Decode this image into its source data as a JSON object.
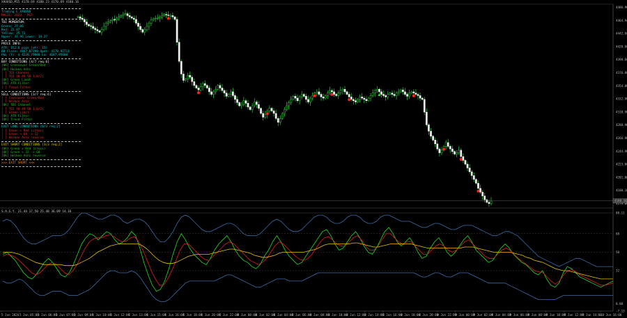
{
  "symbol_line": "XAUUSD,M15  4170.69  4180.23  4170.69  4180.16",
  "indicator_line": "S.A.G.Y.  21.44  17.50  25.48  36.09  14.16",
  "panel": {
    "title": "Trading E  XAUUSD",
    "title_sub": "MAGIC: 2024 · M15",
    "tdi": {
      "header": "TDI MOMENTUM:",
      "lines": [
        "Green: 27.06",
        "Red: 22.87",
        "Yellow: 25.71",
        "Upper: 37.96  Lower: 14.27"
      ]
    },
    "price": {
      "header": "PRICE INFO:",
      "lines": [
        "ATR: 152.6 pips  (atr: 15)",
        "BB Close: 4167.87290  Open: 4178.97711",
        "P&L (Y): $-4220.79800  Lo: 4187.95000"
      ]
    },
    "buy": {
      "header": "BUY CONDITIONS  [4/7  req:6]",
      "items": [
        {
          "state": "ok",
          "text": "[OK] Crossover Green/Red"
        },
        {
          "state": "ok",
          "text": "[OK] Heiken Ashi"
        },
        {
          "state": "no",
          "text": "[ ] TDI Channel"
        },
        {
          "state": "no",
          "text": "[ ] TDI (0-49-50-1,0/2)"
        },
        {
          "state": "ok",
          "text": "[OK] Green Limit"
        },
        {
          "state": "ok",
          "text": "[OK] ATR Filter"
        },
        {
          "state": "no",
          "text": "[ ] Trend Filter"
        }
      ]
    },
    "sell": {
      "header": "SELL CONDITIONS  [3/7  req:6]",
      "items": [
        {
          "state": "no",
          "text": "[ ] Crossover Green/Red"
        },
        {
          "state": "no",
          "text": "[ ] Heiken Ashi"
        },
        {
          "state": "ok",
          "text": "[OK] TDI Channel"
        },
        {
          "state": "no",
          "text": "[ ] TDI (0-49-50-1,0/2)"
        },
        {
          "state": "no",
          "text": "[ ] Green Limit"
        },
        {
          "state": "ok",
          "text": "[OK] ATR Filter"
        },
        {
          "state": "ok",
          "text": "[OK] Trend Filter"
        }
      ]
    },
    "exit_long": {
      "header": "EXIT LONG CONDITIONS  [0/3  req:2]",
      "items": [
        {
          "state": "no",
          "text": "[ ] Green < Red (cross)"
        },
        {
          "state": "no",
          "text": "[ ] Green > 68 -> 32"
        },
        {
          "state": "no",
          "text": "[ ] Heiken Ashi reverse"
        }
      ]
    },
    "exit_short": {
      "header": "EXIT SHORT CONDITIONS  [3/3  req:2]",
      "items": [
        {
          "state": "ok",
          "text": "[OK] Green > Red (cross)"
        },
        {
          "state": "ok",
          "text": "[OK] Green < 32 -> 68"
        },
        {
          "state": "ok",
          "text": "[OK] Heiken Ashi reverse"
        }
      ]
    },
    "signal": ">>> EXIT SHORT <<<"
  },
  "price_axis": [
    "4486.90",
    "4464.94",
    "4442.60",
    "4420.60",
    "4398.60",
    "4376.80",
    "4354.80",
    "4332.90",
    "4310.90",
    "4288.90",
    "4266.90",
    "4244.90",
    "4223.00",
    "4201.00",
    "4180.16",
    "4179.00"
  ],
  "current_price": "4180.16",
  "indicator_axis": [
    "88.11",
    "68",
    "50",
    "32",
    "0.00",
    "-7.13"
  ],
  "time_axis": [
    "5 Jun 2026",
    "5 Jun 05:00",
    "5 Jun 06:00",
    "5 Jun 07:00",
    "5 Jun 09:00",
    "5 Jun 10:00",
    "5 Jun 12:00",
    "5 Jun 13:00",
    "5 Jun 15:00",
    "5 Jun 16:00",
    "5 Jun 18:00",
    "5 Jun 20:00",
    "5 Jun 22:00",
    "8 Jun 00:00",
    "8 Jun 02:00",
    "8 Jun 04:00",
    "8 Jun 06:00",
    "8 Jun 08:00",
    "8 Jun 10:00",
    "8 Jun 12:00",
    "8 Jun 14:00",
    "8 Jun 16:00",
    "8 Jun 18:00",
    "8 Jun 20:00",
    "8 Jun 22:00",
    "9 Jun 00:00",
    "9 Jun 02:00",
    "9 Jun 04:00",
    "9 Jun 06:00",
    "9 Jun 08:00",
    "9 Jun 10:00",
    "9 Jun 12:00",
    "9 Jun 14:00",
    "10 Jun 16:00"
  ],
  "chart_data": {
    "type": "line",
    "price_series_close": [
      4470,
      4468,
      4466,
      4462,
      4458,
      4456,
      4455,
      4452,
      4450,
      4448,
      4446,
      4450,
      4455,
      4460,
      4462,
      4464,
      4466,
      4465,
      4468,
      4470,
      4472,
      4474,
      4475,
      4472,
      4470,
      4468,
      4466,
      4460,
      4455,
      4450,
      4446,
      4450,
      4455,
      4460,
      4465,
      4467,
      4468,
      4468,
      4470,
      4472,
      4474,
      4473,
      4472,
      4472,
      4470,
      4466,
      4430,
      4400,
      4380,
      4370,
      4372,
      4378,
      4375,
      4368,
      4362,
      4358,
      4355,
      4360,
      4365,
      4362,
      4358,
      4352,
      4348,
      4352,
      4356,
      4362,
      4358,
      4354,
      4350,
      4345,
      4348,
      4352,
      4346,
      4340,
      4335,
      4330,
      4332,
      4338,
      4334,
      4328,
      4324,
      4330,
      4336,
      4332,
      4326,
      4318,
      4312,
      4316,
      4322,
      4326,
      4322,
      4318,
      4310,
      4304,
      4310,
      4318,
      4324,
      4330,
      4335,
      4340,
      4345,
      4342,
      4338,
      4344,
      4348,
      4345,
      4340,
      4336,
      4342,
      4346,
      4350,
      4352,
      4348,
      4344,
      4342,
      4346,
      4350,
      4354,
      4352,
      4348,
      4346,
      4350,
      4354,
      4356,
      4352,
      4348,
      4344,
      4340,
      4338,
      4336,
      4340,
      4344,
      4342,
      4340,
      4338,
      4342,
      4346,
      4350,
      4354,
      4356,
      4352,
      4348,
      4346,
      4344,
      4348,
      4350,
      4348,
      4346,
      4350,
      4352,
      4355,
      4352,
      4348,
      4345,
      4350,
      4352,
      4350,
      4348,
      4346,
      4342,
      4340,
      4320,
      4300,
      4290,
      4282,
      4276,
      4270,
      4262,
      4256,
      4260,
      4266,
      4272,
      4266,
      4262,
      4258,
      4254,
      4256,
      4260,
      4250,
      4244,
      4238,
      4232,
      4226,
      4220,
      4214,
      4208,
      4200,
      4194,
      4188,
      4182,
      4178,
      4176,
      4180
    ],
    "signal_marks": [
      {
        "i": 42,
        "dir": "down"
      },
      {
        "i": 56,
        "dir": "down"
      },
      {
        "i": 88,
        "dir": "down"
      },
      {
        "i": 110,
        "dir": "down"
      },
      {
        "i": 118,
        "dir": "down"
      },
      {
        "i": 126,
        "dir": "down"
      },
      {
        "i": 140,
        "dir": "up"
      },
      {
        "i": 156,
        "dir": "down"
      },
      {
        "i": 170,
        "dir": "down"
      },
      {
        "i": 178,
        "dir": "down"
      },
      {
        "i": 186,
        "dir": "down"
      }
    ],
    "ylim": [
      4170,
      4490
    ],
    "indicator": {
      "ylim": [
        -7.13,
        88.11
      ],
      "levels": [
        68,
        50,
        32
      ],
      "series": [
        {
          "color": "#22dd22",
          "values": [
            48,
            50,
            46,
            42,
            36,
            30,
            26,
            24,
            28,
            34,
            40,
            44,
            40,
            34,
            28,
            26,
            30,
            38,
            48,
            58,
            64,
            68,
            66,
            62,
            66,
            70,
            68,
            62,
            58,
            60,
            64,
            70,
            66,
            54,
            40,
            28,
            18,
            12,
            14,
            22,
            34,
            48,
            60,
            68,
            62,
            54,
            48,
            44,
            40,
            38,
            44,
            52,
            58,
            62,
            66,
            60,
            52,
            46,
            42,
            40,
            36,
            34,
            38,
            46,
            52,
            60,
            66,
            60,
            52,
            46,
            42,
            38,
            40,
            46,
            52,
            58,
            64,
            70,
            72,
            66,
            58,
            52,
            54,
            60,
            66,
            70,
            64,
            56,
            50,
            48,
            54,
            62,
            70,
            74,
            68,
            60,
            56,
            60,
            64,
            58,
            50,
            44,
            46,
            54,
            60,
            64,
            58,
            50,
            46,
            50,
            56,
            62,
            66,
            60,
            52,
            48,
            44,
            40,
            42,
            48,
            54,
            58,
            54,
            48,
            44,
            40,
            38,
            34,
            30,
            28,
            32,
            24,
            18,
            16,
            20,
            30,
            36,
            34,
            30,
            26,
            24,
            22,
            20,
            18,
            16,
            18,
            20,
            22
          ]
        },
        {
          "color": "#e02020",
          "values": [
            46,
            48,
            47,
            45,
            42,
            38,
            34,
            30,
            28,
            30,
            34,
            38,
            40,
            38,
            34,
            30,
            28,
            32,
            38,
            46,
            54,
            60,
            63,
            64,
            64,
            66,
            67,
            65,
            62,
            60,
            61,
            64,
            65,
            60,
            52,
            42,
            32,
            24,
            18,
            18,
            24,
            32,
            42,
            52,
            58,
            58,
            54,
            50,
            46,
            43,
            42,
            46,
            50,
            54,
            58,
            60,
            58,
            54,
            50,
            46,
            42,
            40,
            38,
            40,
            44,
            50,
            56,
            60,
            58,
            54,
            50,
            46,
            43,
            42,
            44,
            48,
            54,
            60,
            64,
            65,
            62,
            58,
            56,
            56,
            60,
            64,
            66,
            62,
            56,
            52,
            52,
            56,
            62,
            68,
            68,
            64,
            60,
            58,
            60,
            60,
            56,
            52,
            48,
            48,
            52,
            56,
            58,
            56,
            52,
            50,
            52,
            56,
            60,
            62,
            58,
            54,
            50,
            46,
            44,
            44,
            48,
            52,
            54,
            52,
            48,
            44,
            41,
            38,
            35,
            32,
            31,
            30,
            26,
            22,
            19,
            22,
            28,
            32,
            33,
            31,
            28,
            26,
            24,
            22,
            20,
            18,
            18,
            19,
            20
          ]
        },
        {
          "color": "#e8c000",
          "values": [
            50,
            50,
            50,
            49,
            48,
            46,
            44,
            42,
            40,
            39,
            38,
            38,
            38,
            38,
            38,
            37,
            37,
            37,
            38,
            40,
            42,
            44,
            47,
            50,
            52,
            54,
            56,
            57,
            58,
            58,
            58,
            58,
            58,
            58,
            56,
            53,
            49,
            45,
            42,
            40,
            39,
            39,
            40,
            42,
            44,
            46,
            47,
            48,
            48,
            48,
            48,
            49,
            50,
            51,
            52,
            53,
            53,
            52,
            51,
            50,
            49,
            47,
            46,
            45,
            45,
            46,
            47,
            49,
            50,
            50,
            50,
            50,
            50,
            50,
            51,
            52,
            53,
            55,
            57,
            58,
            58,
            58,
            58,
            58,
            58,
            59,
            59,
            58,
            57,
            56,
            55,
            55,
            56,
            57,
            58,
            58,
            58,
            58,
            58,
            58,
            57,
            56,
            55,
            54,
            54,
            54,
            54,
            54,
            54,
            54,
            54,
            54,
            55,
            55,
            55,
            54,
            53,
            52,
            51,
            50,
            50,
            50,
            50,
            50,
            49,
            48,
            47,
            45,
            44,
            42,
            41,
            40,
            38,
            36,
            34,
            33,
            32,
            32,
            31,
            30,
            29,
            28,
            27,
            26,
            25,
            24,
            24,
            24,
            24
          ]
        },
        {
          "color": "#3a6ea8",
          "values": [
            80,
            82,
            80,
            76,
            70,
            64,
            60,
            58,
            58,
            60,
            62,
            64,
            66,
            66,
            66,
            68,
            72,
            78,
            84,
            88,
            88,
            86,
            84,
            82,
            82,
            84,
            86,
            86,
            84,
            80,
            78,
            80,
            82,
            82,
            80,
            76,
            70,
            64,
            60,
            60,
            64,
            70,
            78,
            84,
            86,
            84,
            80,
            76,
            72,
            70,
            70,
            72,
            74,
            76,
            78,
            78,
            76,
            72,
            68,
            66,
            66,
            66,
            68,
            72,
            76,
            80,
            82,
            80,
            76,
            72,
            70,
            70,
            72,
            76,
            80,
            84,
            86,
            86,
            84,
            80,
            78,
            78,
            80,
            84,
            86,
            86,
            84,
            80,
            78,
            78,
            80,
            84,
            86,
            86,
            84,
            82,
            80,
            80,
            80,
            78,
            76,
            74,
            74,
            76,
            78,
            78,
            76,
            74,
            72,
            72,
            74,
            76,
            76,
            76,
            74,
            72,
            70,
            68,
            66,
            66,
            68,
            70,
            70,
            68,
            66,
            62,
            58,
            54,
            50,
            46,
            44,
            42,
            40,
            38,
            36,
            38,
            40,
            42,
            44,
            44,
            42,
            40,
            38,
            36,
            36,
            36,
            36,
            36
          ]
        },
        {
          "color": "#3a6ea8",
          "values": [
            22,
            20,
            20,
            22,
            24,
            22,
            18,
            14,
            10,
            8,
            8,
            10,
            12,
            12,
            12,
            10,
            8,
            8,
            8,
            10,
            12,
            14,
            18,
            22,
            26,
            30,
            32,
            32,
            30,
            30,
            30,
            32,
            30,
            26,
            20,
            14,
            8,
            4,
            2,
            2,
            4,
            8,
            12,
            16,
            20,
            22,
            22,
            22,
            22,
            22,
            22,
            22,
            24,
            26,
            28,
            28,
            26,
            24,
            22,
            20,
            18,
            16,
            16,
            18,
            20,
            22,
            24,
            24,
            24,
            22,
            22,
            22,
            22,
            24,
            26,
            28,
            30,
            30,
            30,
            30,
            30,
            30,
            30,
            30,
            30,
            30,
            30,
            30,
            30,
            30,
            30,
            30,
            30,
            30,
            30,
            30,
            30,
            30,
            30,
            30,
            28,
            26,
            26,
            28,
            30,
            30,
            28,
            26,
            26,
            28,
            30,
            30,
            30,
            28,
            26,
            24,
            22,
            20,
            20,
            20,
            20,
            20,
            18,
            16,
            14,
            12,
            10,
            8,
            6,
            4,
            4,
            4,
            4,
            4,
            6,
            8,
            8,
            8,
            8,
            8,
            8,
            8,
            8,
            8,
            8,
            8,
            8,
            8
          ]
        }
      ]
    }
  }
}
